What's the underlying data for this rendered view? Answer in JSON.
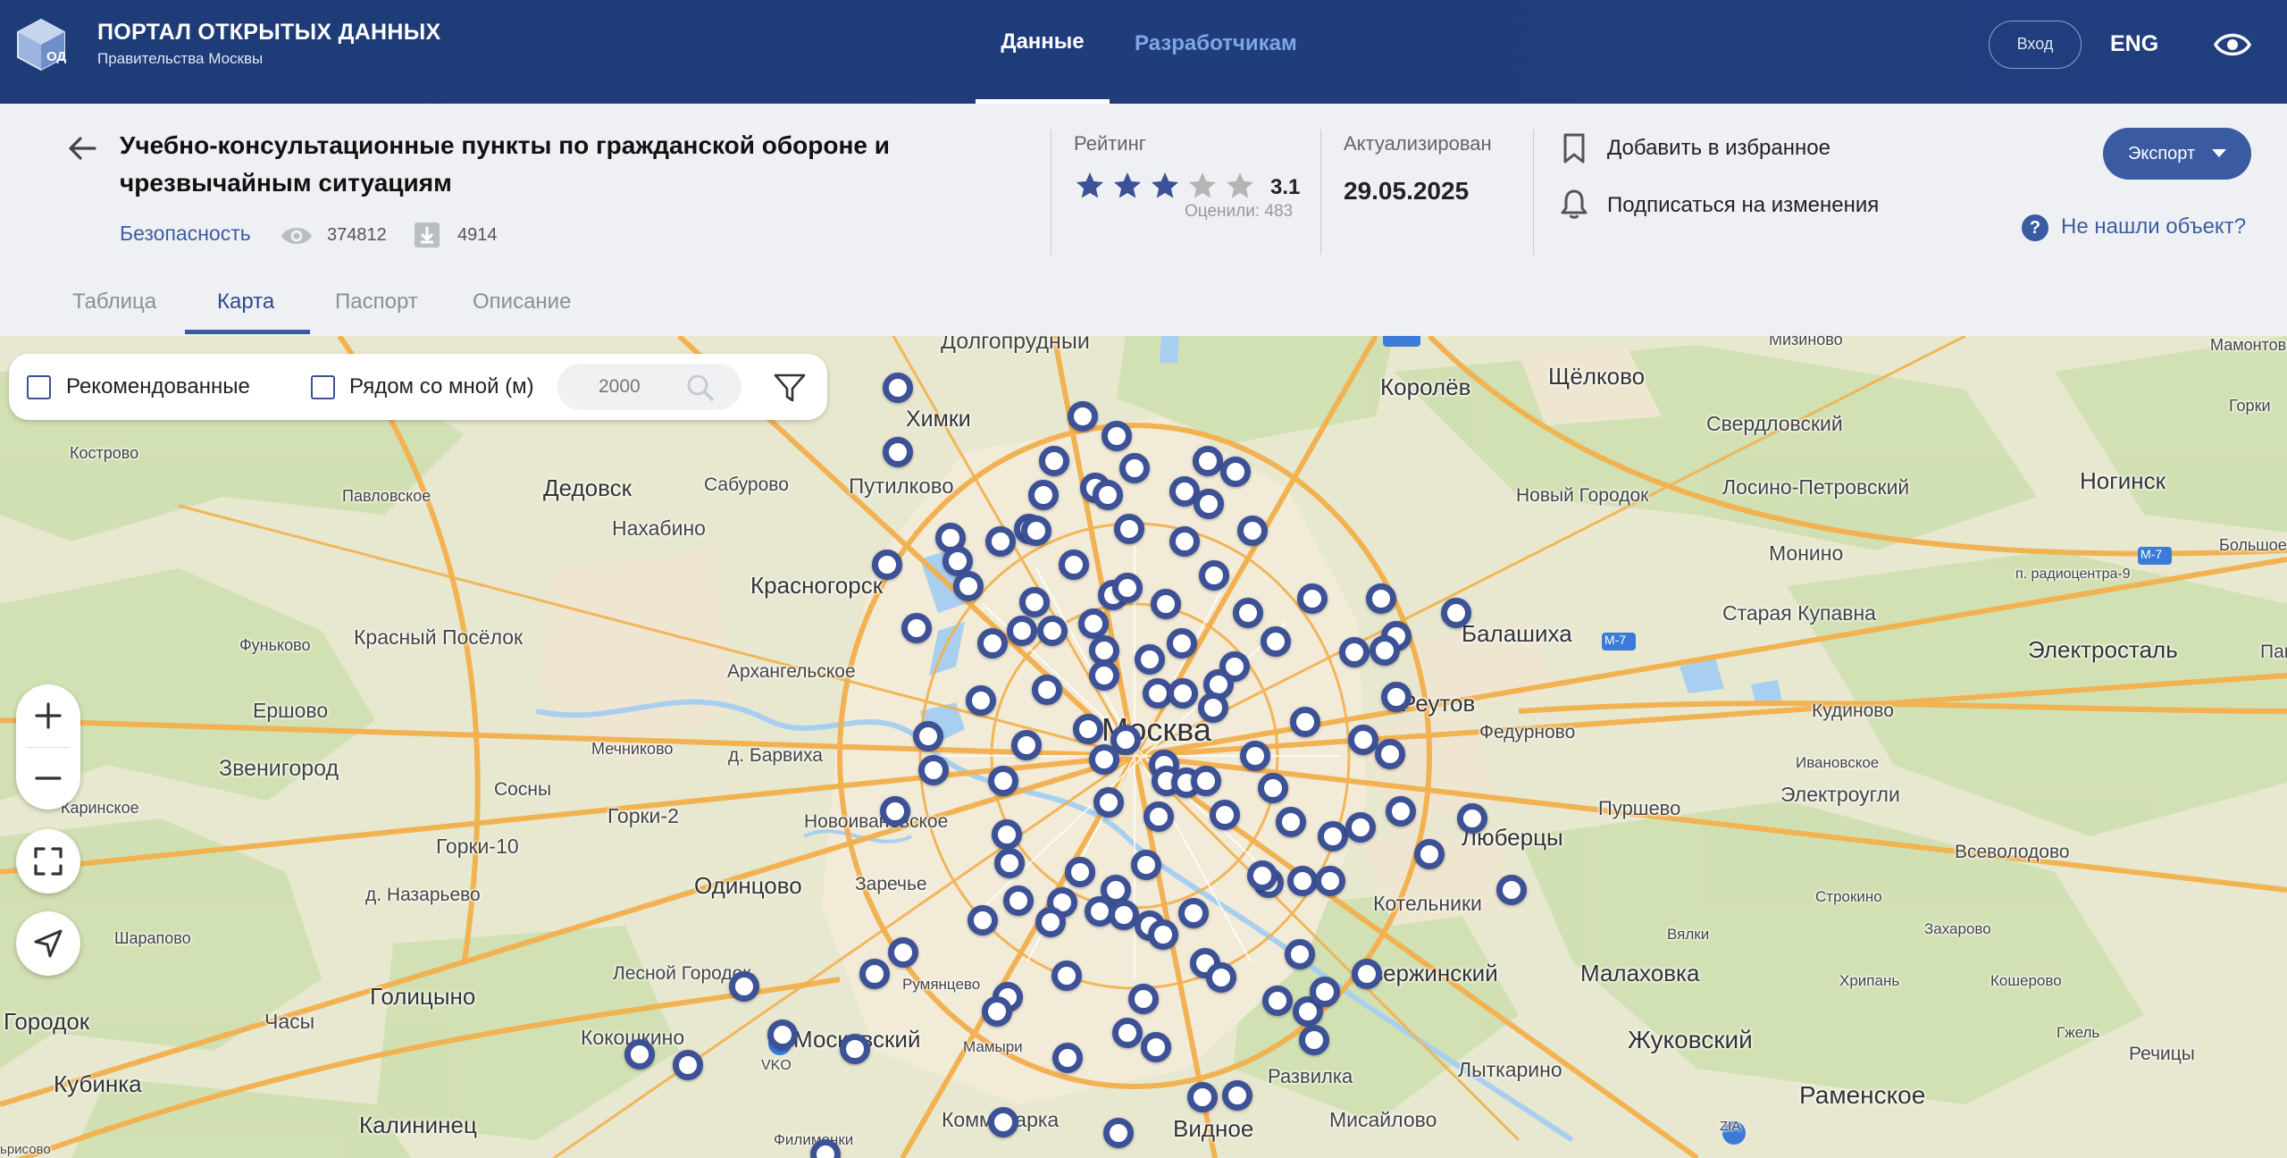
{
  "brand": {
    "title": "ПОРТАЛ ОТКРЫТЫХ ДАННЫХ",
    "subtitle": "Правительства Москвы",
    "logo_text": "ОД"
  },
  "nav": {
    "data": "Данные",
    "developers": "Разработчикам",
    "login": "Вход",
    "lang": "ENG"
  },
  "dataset": {
    "title": "Учебно-консультационные пункты по гражданской обороне и чрезвычайным ситуациям",
    "category": "Безопасность",
    "views": "374812",
    "downloads": "4914"
  },
  "rating": {
    "label": "Рейтинг",
    "value": "3.1",
    "stars_filled": 3,
    "stars_total": 5,
    "rated": "Оценили: 483"
  },
  "updated": {
    "label": "Актуализирован",
    "date": "29.05.2025"
  },
  "actions": {
    "favorite": "Добавить в избранное",
    "subscribe": "Подписаться на изменения",
    "export": "Экспорт",
    "not_found": "Не нашли объект?"
  },
  "tabs": [
    "Таблица",
    "Карта",
    "Паспорт",
    "Описание"
  ],
  "active_tab": "Карта",
  "map_filters": {
    "recommended": "Рекомендованные",
    "near_me": "Рядом со мной (м)",
    "radius_placeholder": "2000"
  },
  "colors": {
    "nav_bg": "#1f3d7a",
    "accent": "#3a5aa2",
    "marker": "#3c5196",
    "star_filled": "#3c5196",
    "star_empty": "#b5b5b5"
  },
  "map_labels": {
    "moskva": "Москва",
    "dolgoprudny": "Долгопрудный",
    "khimki": "Химки",
    "korolev": "Королёв",
    "shchelkovo": "Щёлково",
    "mizinovo": "Мизиново",
    "mamontovo": "Мамонтово",
    "gorki_ne": "Горки",
    "sverdlovsky": "Свердловский",
    "losino": "Лосино-Петровский",
    "noginsk": "Ногинск",
    "bolshoe": "Большое",
    "kostrovo": "Кострово",
    "dedovsk": "Дедовск",
    "saburovo": "Сабурово",
    "putilkovo": "Путилково",
    "pavlovskoe": "Павловское",
    "nakhabino": "Нахабино",
    "novy_gorodok": "Новый Городок",
    "monino": "Монино",
    "radiocentr": "п. радиоцентра-9",
    "krasnogorsk": "Красногорск",
    "staraya_kupavna": "Старая Купавна",
    "balashikha": "Балашиха",
    "elektrostal": "Электросталь",
    "pav": "Пав",
    "funkovo": "Фуньково",
    "krasny_posyolok": "Красный Посёлок",
    "arkhangelskoe": "Архангельское",
    "reutov": "Реутов",
    "kudinovo": "Кудиново",
    "ershovo": "Ершово",
    "mechnikovo": "Мечниково",
    "zvenigorod": "Звенигород",
    "d_barvikha": "д. Барвиха",
    "fedurnovo": "Федурново",
    "ivanisovo": "Ивановское",
    "karinskoe": "Каринское",
    "sosny": "Сосны",
    "gorki2": "Горки-2",
    "novoivanovskoe": "Новоивановское",
    "purshevo": "Пуршево",
    "elektrougli": "Электроугли",
    "gorki10": "Горки-10",
    "odintsovo": "Одинцово",
    "zarechye": "Заречье",
    "lyubertsy": "Люберцы",
    "vsevolodovo": "Всеволодово",
    "d_nazarevo": "д. Назарьево",
    "kotelniki": "Котельники",
    "stroykino": "Строкино",
    "sharapovo": "Шарапово",
    "vyalki": "Вялки",
    "zakharovo": "Захарово",
    "golitsyno": "Голицыно",
    "lesnoy_gorodok": "Лесной Городок",
    "rumyantsevo": "Румянцево",
    "dzerzhinsky": "Дзержинский",
    "malakhovka": "Малаховка",
    "khripan": "Хрипань",
    "koshcherovo": "Кошерово",
    "gorodok": "Городок",
    "chasy": "Часы",
    "kokoshkino": "Кокошкино",
    "moskovsky": "Московский",
    "mamyri": "Мамыри",
    "razvilka": "Развилка",
    "lytkarino": "Лыткарино",
    "zhukovsky": "Жуковский",
    "gzhel": "Гжель",
    "kubinka": "Кубинка",
    "vko": "VKO",
    "ramenskoe": "Раменское",
    "rechitsy": "Речицы",
    "kalininets": "Калининец",
    "kommunarka": "Коммунарка",
    "vidnoe": "Видное",
    "misaylovo": "Мисайлово",
    "zia": "ZIA",
    "filimonki": "Филимонки",
    "m7": "М-7",
    "m7b": "М-7",
    "borisovo": "ьрисово"
  }
}
